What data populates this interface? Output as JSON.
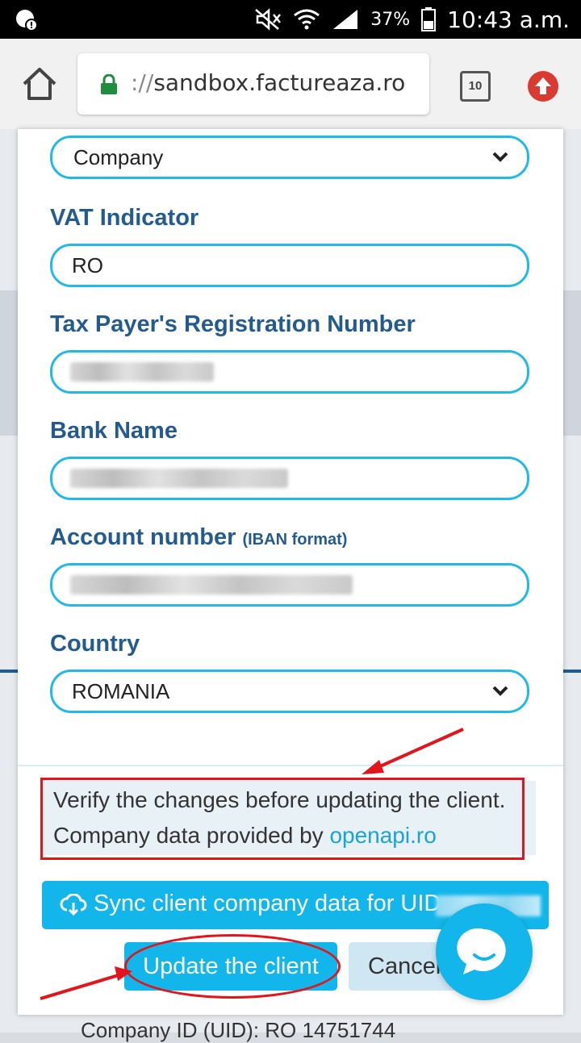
{
  "status_bar": {
    "battery_percent": "37%",
    "time": "10:43 a.m."
  },
  "browser": {
    "url_scheme": "://",
    "url_host": "sandbox.factureaza.ro",
    "tab_count": "10"
  },
  "form": {
    "type_select_value": "Company",
    "vat_label": "VAT Indicator",
    "vat_value": "RO",
    "tax_id_label": "Tax Payer's Registration Number",
    "bank_label": "Bank Name",
    "account_label": "Account number",
    "account_label_suffix": "(IBAN format)",
    "country_label": "Country",
    "country_value": "ROMANIA"
  },
  "info": {
    "line1": "Verify the changes before updating the client.",
    "line2_prefix": "Company data provided by ",
    "line2_link": "openapi.ro"
  },
  "buttons": {
    "sync_label": "Sync client company data for UID",
    "update_label": "Update the client",
    "cancel_label": "Cancel"
  },
  "background": {
    "partial_text": "Company ID (UID): RO 14751744"
  },
  "colors": {
    "accent": "#12b6ea",
    "label": "#245b8e",
    "annotation": "#e2141c"
  }
}
